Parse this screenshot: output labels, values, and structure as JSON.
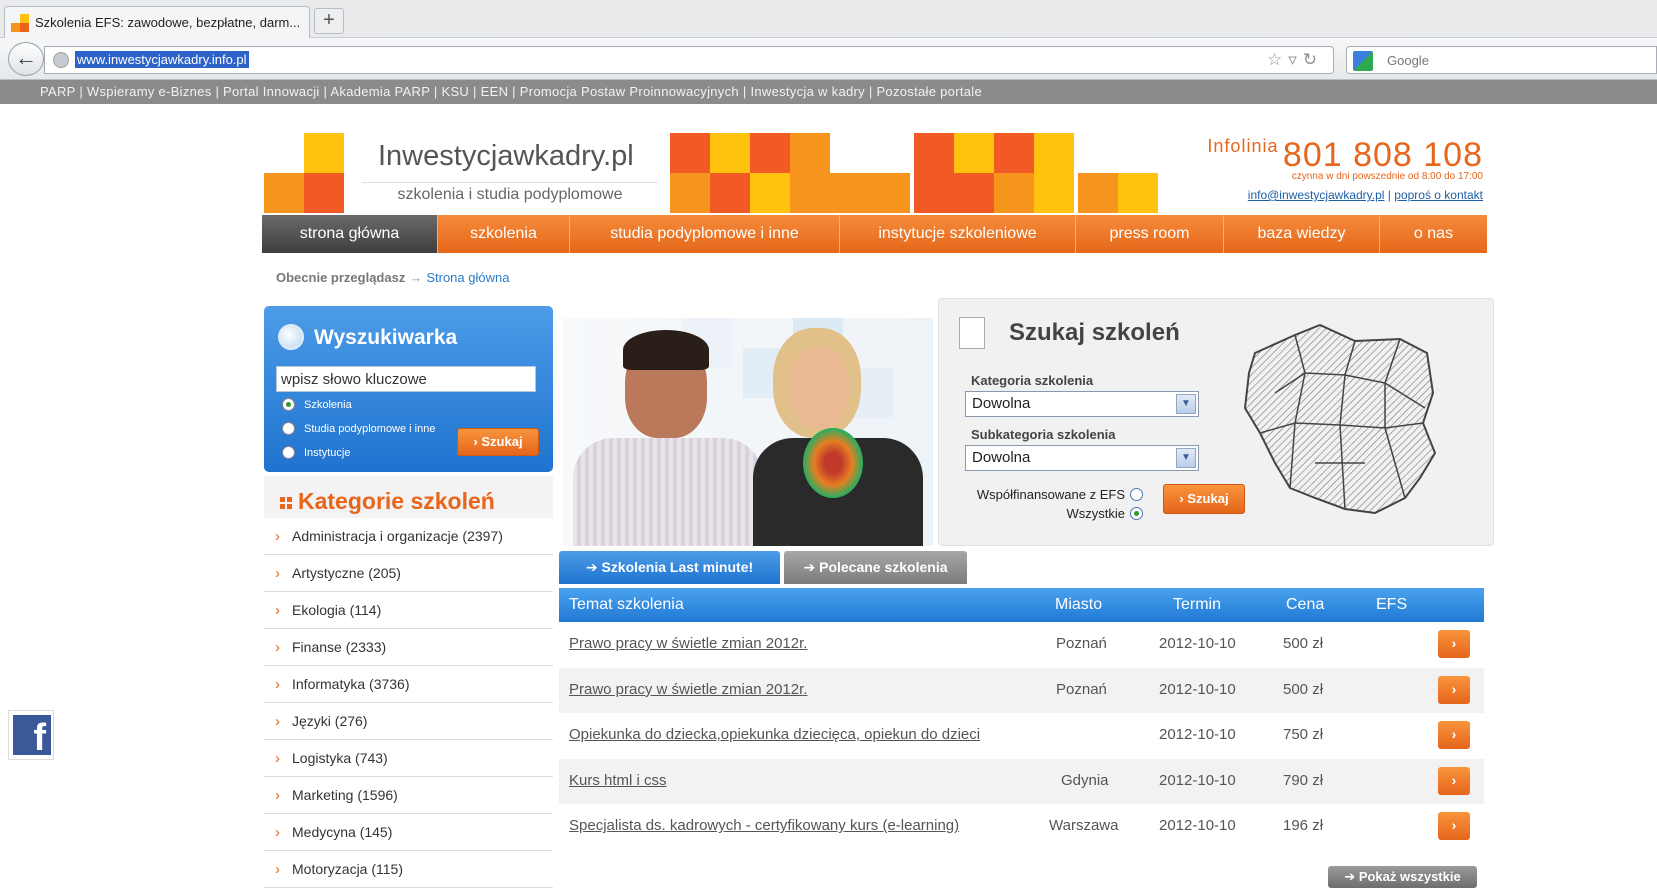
{
  "browser": {
    "tab_title": "Szkolenia EFS: zawodowe, bezpłatne, darm...",
    "new_tab": "+",
    "url": "www.inwestycjawkadry.info.pl",
    "search_engine": "Google"
  },
  "portal_bar": [
    "PARP",
    "Wspieramy e-Biznes",
    "Portal Innowacji",
    "Akademia PARP",
    "KSU",
    "EEN",
    "Promocja Postaw Proinnowacyjnych",
    "Inwestycja w kadry",
    "Pozostałe portale"
  ],
  "header": {
    "logo": "Inwestycjawkadry.pl",
    "tagline": "szkolenia i studia podyplomowe",
    "infolinia_label": "Infolinia",
    "phone": "801 808 108",
    "hours": "czynna w dni powszednie od 8:00 do 17:00",
    "email": "info@inwestycjawkadry.pl",
    "contact": "poproś o kontakt"
  },
  "nav": [
    {
      "label": "strona główna",
      "active": true
    },
    {
      "label": "szkolenia"
    },
    {
      "label": "studia podyplomowe i inne"
    },
    {
      "label": "instytucje szkoleniowe"
    },
    {
      "label": "press room"
    },
    {
      "label": "baza wiedzy"
    },
    {
      "label": "o nas"
    }
  ],
  "breadcrumb": {
    "prefix": "Obecnie przeglądasz",
    "current": "Strona główna"
  },
  "search_widget": {
    "title": "Wyszukiwarka",
    "input_value": "wpisz słowo kluczowe",
    "options": [
      "Szkolenia",
      "Studia podyplomowe i inne",
      "Instytucje"
    ],
    "selected_option": "Szkolenia",
    "button": "Szukaj"
  },
  "categories": {
    "title": "Kategorie szkoleń",
    "items": [
      "Administracja i organizacje (2397)",
      "Artystyczne (205)",
      "Ekologia (114)",
      "Finanse (2333)",
      "Informatyka (3736)",
      "Języki (276)",
      "Logistyka (743)",
      "Marketing (1596)",
      "Medycyna (145)",
      "Motoryzacja (115)"
    ]
  },
  "course_search": {
    "title": "Szukaj szkoleń",
    "category_label": "Kategoria szkolenia",
    "category_value": "Dowolna",
    "subcategory_label": "Subkategoria szkolenia",
    "subcategory_value": "Dowolna",
    "efs_label": "Współfinansowane z EFS",
    "all_label": "Wszystkie",
    "selected": "Wszystkie",
    "button": "Szukaj"
  },
  "tabs": [
    "Szkolenia Last minute!",
    "Polecane szkolenia"
  ],
  "table": {
    "headers": [
      "Temat szkolenia",
      "Miasto",
      "Termin",
      "Cena",
      "EFS"
    ],
    "rows": [
      {
        "temat": "Prawo pracy w świetle zmian 2012r.",
        "miasto": "Poznań",
        "termin": "2012-10-10",
        "cena": "500 zł"
      },
      {
        "temat": "Prawo pracy w świetle zmian 2012r.",
        "miasto": "Poznań",
        "termin": "2012-10-10",
        "cena": "500 zł"
      },
      {
        "temat": "Opiekunka do dziecka,opiekunka dziecięca, opiekun do dzieci",
        "miasto": "",
        "termin": "2012-10-10",
        "cena": "750 zł"
      },
      {
        "temat": "Kurs html i css",
        "miasto": "Gdynia",
        "termin": "2012-10-10",
        "cena": "790 zł"
      },
      {
        "temat": "Specjalista ds. kadrowych - certyfikowany kurs (e-learning)",
        "miasto": "Warszawa",
        "termin": "2012-10-10",
        "cena": "196 zł"
      }
    ]
  },
  "show_all": "Pokaż wszystkie",
  "colors": {
    "accent_orange": "#e8651a",
    "accent_blue": "#2179d4",
    "facebook": "#3b5998"
  }
}
